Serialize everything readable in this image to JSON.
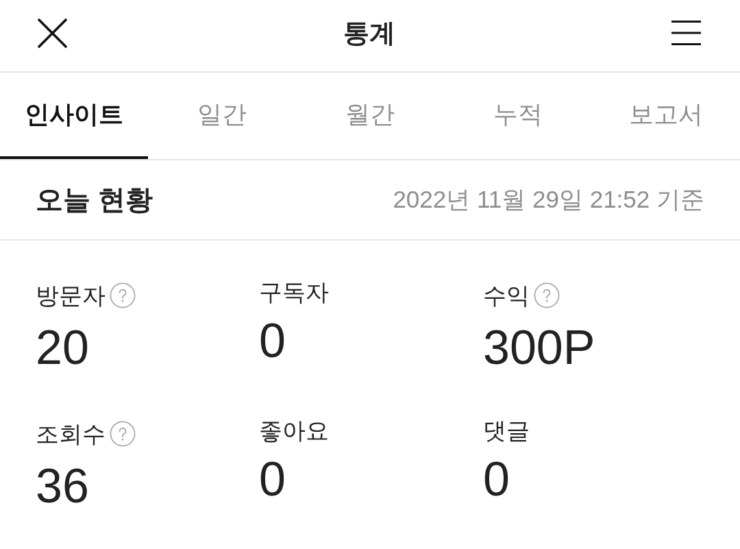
{
  "header": {
    "title": "통계"
  },
  "tabs": [
    {
      "label": "인사이트",
      "selected": true
    },
    {
      "label": "일간",
      "selected": false
    },
    {
      "label": "월간",
      "selected": false
    },
    {
      "label": "누적",
      "selected": false
    },
    {
      "label": "보고서",
      "selected": false
    }
  ],
  "summary": {
    "title": "오늘 현황",
    "timestamp": "2022년 11월 29일 21:52 기준"
  },
  "stats": [
    {
      "label": "방문자",
      "help": true,
      "value": "20"
    },
    {
      "label": "구독자",
      "help": false,
      "value": "0"
    },
    {
      "label": "수익",
      "help": true,
      "value": "300P"
    },
    {
      "label": "조회수",
      "help": true,
      "value": "36"
    },
    {
      "label": "좋아요",
      "help": false,
      "value": "0"
    },
    {
      "label": "댓글",
      "help": false,
      "value": "0"
    }
  ]
}
